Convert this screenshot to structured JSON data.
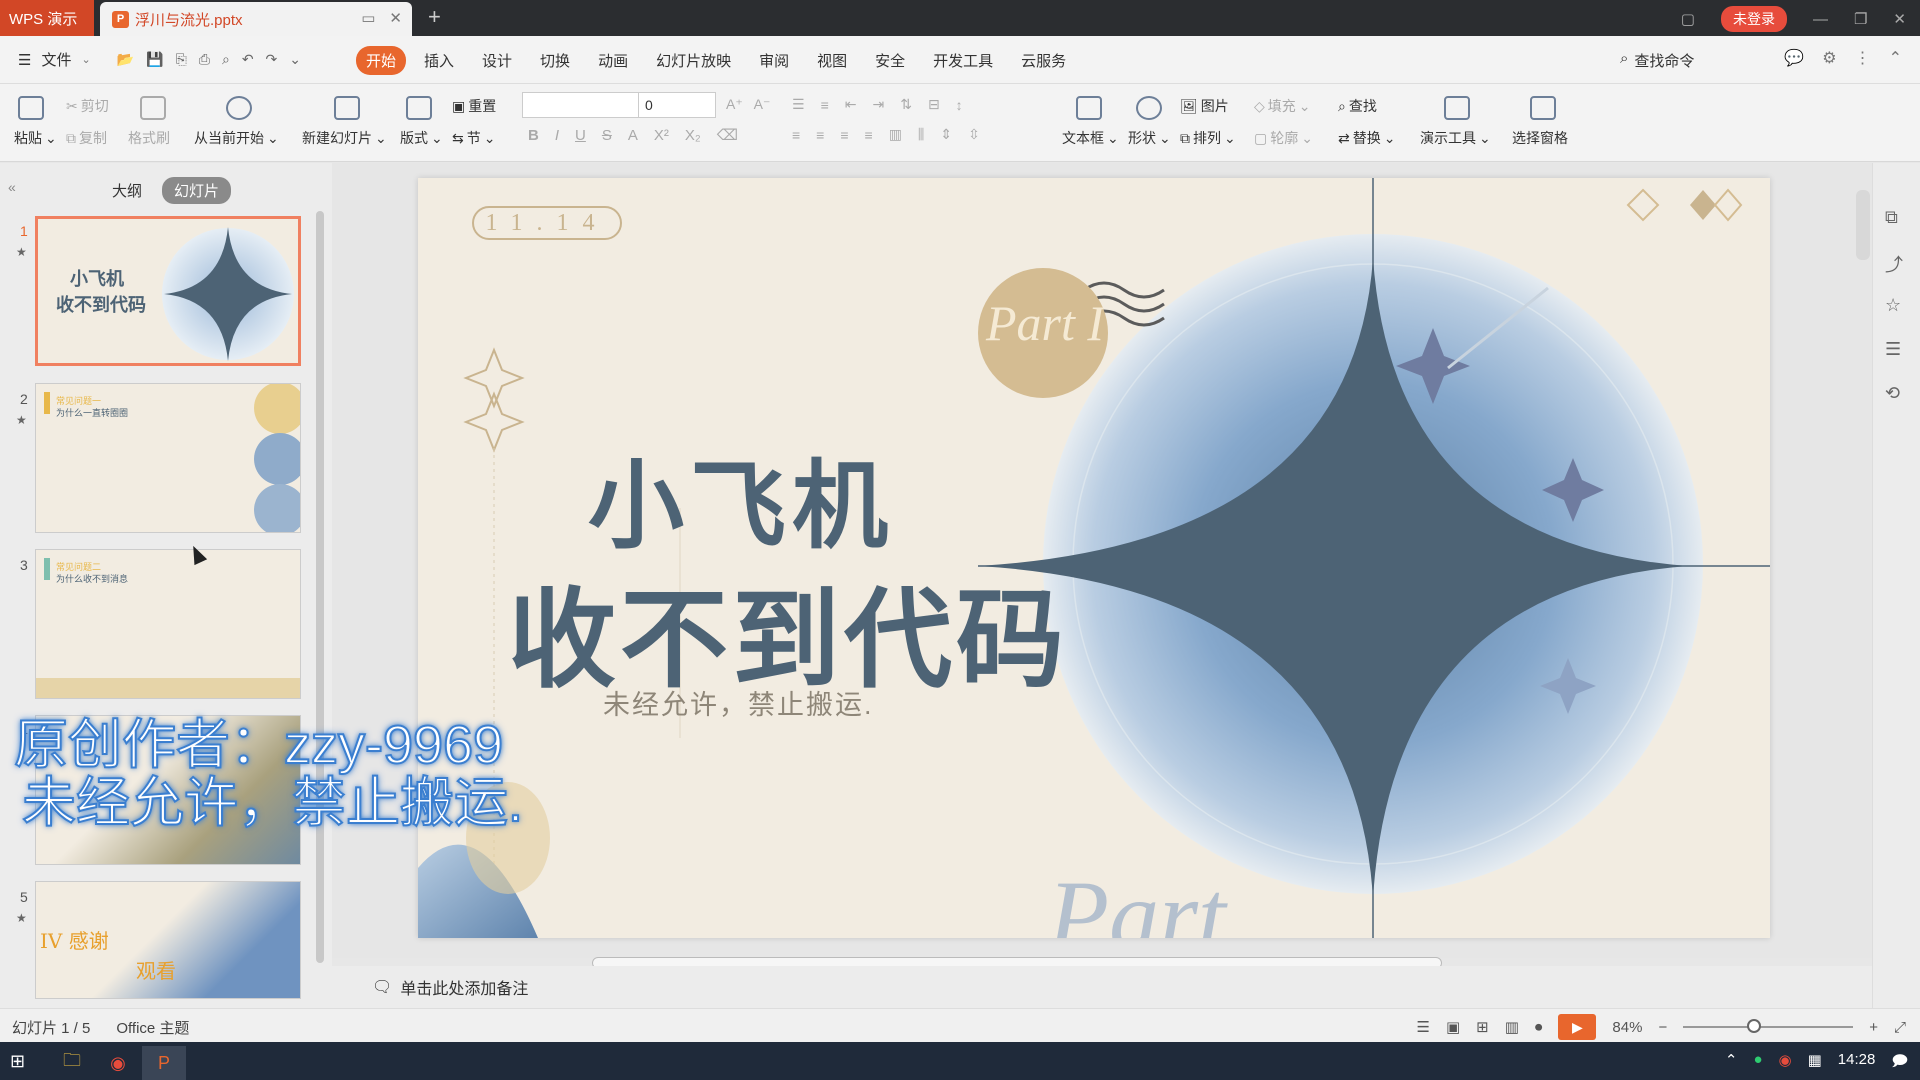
{
  "app": {
    "title": "WPS 演示",
    "file_name": "浮川与流光.pptx",
    "login_label": "未登录",
    "brand_color": "#d24726"
  },
  "menu": {
    "file_label": "文件",
    "tabs": [
      "开始",
      "插入",
      "设计",
      "切换",
      "动画",
      "幻灯片放映",
      "审阅",
      "视图",
      "安全",
      "开发工具",
      "云服务"
    ],
    "active_tab": "开始",
    "search_label": "查找命令"
  },
  "ribbon": {
    "paste": "粘贴",
    "cut": "剪切",
    "copy": "复制",
    "format_painter": "格式刷",
    "play_from_current": "从当前开始",
    "new_slide": "新建幻灯片",
    "layout": "版式",
    "reset": "重置",
    "section": "节",
    "font_size": "0",
    "textbox": "文本框",
    "shape": "形状",
    "picture": "图片",
    "arrange": "排列",
    "fill": "填充",
    "outline": "轮廓",
    "find": "查找",
    "replace": "替换",
    "presentation_tools": "演示工具",
    "selection_pane": "选择窗格"
  },
  "left_panel": {
    "tabs": [
      "大纲",
      "幻灯片"
    ],
    "active_tab": "幻灯片",
    "thumbnails": [
      {
        "number": "1",
        "text": "小飞机\n收不到代码",
        "starred": true
      },
      {
        "number": "2",
        "text": "常见问题一 为什么一直转圈圈",
        "starred": true
      },
      {
        "number": "3",
        "text": "常见问题二 为什么收不到消息",
        "starred": false
      },
      {
        "number": "4",
        "text": "",
        "starred": false
      },
      {
        "number": "5",
        "text": "IV 感谢观看",
        "starred": true
      }
    ]
  },
  "slide": {
    "date_badge": "11.14",
    "part_stamp": "Part I",
    "title_line1": "小飞机",
    "title_line2": "收不到代码",
    "subtitle": "未经允许，禁止搬运.",
    "part_bottom": "Part"
  },
  "notes_placeholder": "单击此处添加备注",
  "status": {
    "slide_counter": "幻灯片 1 / 5",
    "theme": "Office 主题",
    "zoom": "84%"
  },
  "overlay": {
    "line1": "原创作者：zzy-9969",
    "line2": "未经允许，禁止搬运."
  },
  "taskbar": {
    "time": "14:28"
  }
}
